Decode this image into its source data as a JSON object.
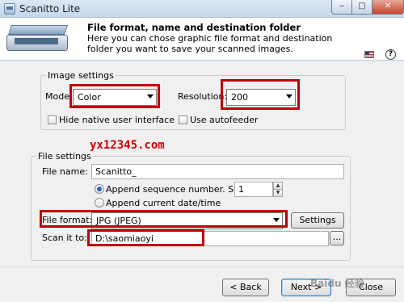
{
  "window": {
    "title": "Scanitto Lite",
    "minimize_glyph": "‒",
    "maximize_glyph": "□",
    "close_glyph": "✕"
  },
  "header": {
    "title": "File format, name and destination folder",
    "description": "Here you can chose graphic file format and destination folder you want to save your scanned images.",
    "language_icon": "us-flag-icon",
    "help_icon": "help-icon",
    "help_glyph": "?"
  },
  "image_settings": {
    "group_title": "Image settings",
    "mode_label": "Mode:",
    "mode_value": "Color",
    "resolution_label": "Resolution:",
    "resolution_value": "200",
    "hide_native_ui_label": "Hide native user interface",
    "hide_native_ui_checked": false,
    "use_autofeeder_label": "Use autofeeder",
    "use_autofeeder_checked": false
  },
  "file_settings": {
    "group_title": "File settings",
    "file_name_label": "File name:",
    "file_name_value": "Scanitto_",
    "append_sequence_label": "Append sequence number. Start at:",
    "append_sequence_selected": true,
    "start_at_value": "1",
    "append_date_label": "Append current date/time",
    "append_date_selected": false,
    "file_format_label": "File format:",
    "file_format_value": "JPG (JPEG)",
    "settings_button": "Settings",
    "scan_to_label": "Scan it to:",
    "scan_to_value": "D:\\saomiaoyi",
    "browse_button": "..."
  },
  "watermark_text": "yx12345.com",
  "footer": {
    "back_button": "< Back",
    "next_button": "Next >",
    "close_button": "Close",
    "site_mark": "Baidu 经验"
  },
  "colors": {
    "highlight_box": "#c0000b",
    "watermark": "#d60000"
  }
}
